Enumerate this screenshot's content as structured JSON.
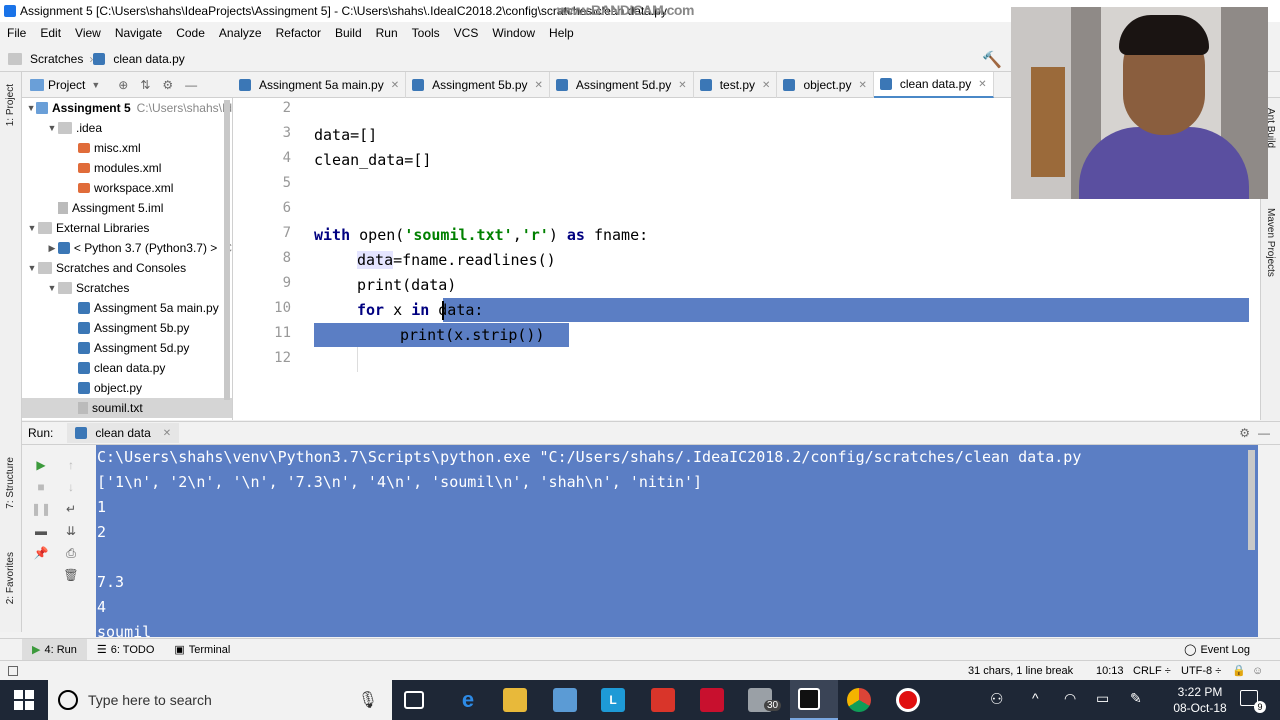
{
  "window_title": "Assignment 5 [C:\\Users\\shahs\\IdeaProjects\\Assingment 5] - C:\\Users\\shahs\\.IdeaIC2018.2\\config\\scratches\\clean data.py",
  "watermark": "www.BANDICAM.com",
  "menu": [
    "File",
    "Edit",
    "View",
    "Navigate",
    "Code",
    "Analyze",
    "Refactor",
    "Build",
    "Run",
    "Tools",
    "VCS",
    "Window",
    "Help"
  ],
  "breadcrumb": [
    "Scratches",
    "clean data.py"
  ],
  "left_tabs": [
    "1: Project",
    "7: Structure",
    "2: Favorites"
  ],
  "right_tabs": [
    "Ant Build",
    "Maven Projects"
  ],
  "project_panel": {
    "title": "Project"
  },
  "tree": [
    {
      "label": "Assingment 5",
      "extra": "C:\\Users\\shahs\\Id",
      "indent": 0,
      "arrow": "▼",
      "icon": "folder blue",
      "bold": true
    },
    {
      "label": ".idea",
      "indent": 1,
      "arrow": "▼",
      "icon": "folder"
    },
    {
      "label": "misc.xml",
      "indent": 2,
      "arrow": "",
      "icon": "xmlic"
    },
    {
      "label": "modules.xml",
      "indent": 2,
      "arrow": "",
      "icon": "xmlic"
    },
    {
      "label": "workspace.xml",
      "indent": 2,
      "arrow": "",
      "icon": "xmlic"
    },
    {
      "label": "Assingment 5.iml",
      "indent": 1,
      "arrow": "",
      "icon": "txtic"
    },
    {
      "label": "External Libraries",
      "indent": 0,
      "arrow": "▼",
      "icon": "folder"
    },
    {
      "label": "< Python 3.7 (Python3.7) >",
      "extra": "C",
      "indent": 1,
      "arrow": "▶",
      "icon": "pyic"
    },
    {
      "label": "Scratches and Consoles",
      "indent": 0,
      "arrow": "▼",
      "icon": "folder"
    },
    {
      "label": "Scratches",
      "indent": 1,
      "arrow": "▼",
      "icon": "folder"
    },
    {
      "label": "Assingment 5a main.py",
      "indent": 2,
      "arrow": "",
      "icon": "pyic"
    },
    {
      "label": "Assingment 5b.py",
      "indent": 2,
      "arrow": "",
      "icon": "pyic"
    },
    {
      "label": "Assingment 5d.py",
      "indent": 2,
      "arrow": "",
      "icon": "pyic"
    },
    {
      "label": "clean data.py",
      "indent": 2,
      "arrow": "",
      "icon": "pyic"
    },
    {
      "label": "object.py",
      "indent": 2,
      "arrow": "",
      "icon": "pyic"
    },
    {
      "label": "soumil.txt",
      "indent": 2,
      "arrow": "",
      "icon": "txtic",
      "selected": true
    }
  ],
  "tabs": [
    {
      "label": "Assingment 5a main.py",
      "active": false
    },
    {
      "label": "Assingment 5b.py",
      "active": false
    },
    {
      "label": "Assingment 5d.py",
      "active": false
    },
    {
      "label": "test.py",
      "active": false
    },
    {
      "label": "object.py",
      "active": false
    },
    {
      "label": "clean data.py",
      "active": true
    }
  ],
  "line_numbers": [
    "2",
    "3",
    "4",
    "5",
    "6",
    "7",
    "8",
    "9",
    "10",
    "11",
    "12"
  ],
  "code": {
    "l3": "data=[]",
    "l4": "clean_data=[]",
    "l7_kw1": "with",
    "l7_open": " open(",
    "l7_s1": "'soumil.txt'",
    "l7_c": ",",
    "l7_s2": "'r'",
    "l7_cl": ") ",
    "l7_kw2": "as",
    "l7_rest": " fname:",
    "l8_var": "data",
    "l8_rest": "=fname.readlines()",
    "l9": "print(data)",
    "l10_kw": "for",
    "l10_x": " x ",
    "l10_in": "in",
    "l10_rest": " data:",
    "l11": "print(x.strip())"
  },
  "run": {
    "label": "Run:",
    "config": "clean data"
  },
  "console_lines": [
    "C:\\Users\\shahs\\venv\\Python3.7\\Scripts\\python.exe \"C:/Users/shahs/.IdeaIC2018.2/config/scratches/clean data.py",
    "['1\\n', '2\\n', '\\n', '7.3\\n', '4\\n', 'soumil\\n', 'shah\\n', 'nitin']",
    "1",
    "2",
    "",
    "7.3",
    "4",
    "soumil"
  ],
  "bottom_tabs": [
    "4: Run",
    "6: TODO",
    "Terminal"
  ],
  "event_log": "Event Log",
  "status": {
    "selection": "31 chars, 1 line break",
    "position": "10:13",
    "line_sep": "CRLF ÷",
    "encoding": "UTF-8 ÷"
  },
  "taskbar": {
    "search_placeholder": "Type here to search",
    "time": "3:22 PM",
    "date": "08-Oct-18",
    "mail_badge": "30",
    "notif": "9"
  },
  "colors": {
    "selection": "#5b7ec4",
    "keyword": "#000080",
    "string": "#008000",
    "taskbar": "#1e2736"
  }
}
